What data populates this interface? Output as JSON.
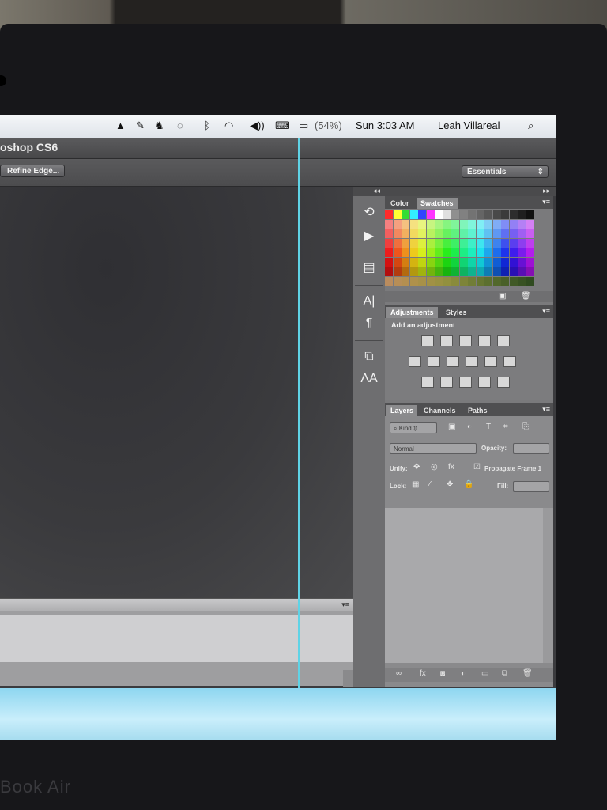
{
  "menubar": {
    "battery_percent": "(54%)",
    "clock": "Sun 3:03 AM",
    "user": "Leah Villareal",
    "search_icon": "magnifier"
  },
  "app": {
    "title": "oshop CS6",
    "refine_edge_label": "Refine Edge...",
    "workspace": "Essentials"
  },
  "color_panel": {
    "tabs": [
      "Color",
      "Swatches"
    ],
    "active_tab": "Swatches"
  },
  "adjustments_panel": {
    "tabs": [
      "Adjustments",
      "Styles"
    ],
    "active_tab": "Adjustments",
    "heading": "Add an adjustment"
  },
  "layers_panel": {
    "tabs": [
      "Layers",
      "Channels",
      "Paths"
    ],
    "active_tab": "Layers",
    "kind_filter": "Kind",
    "blend_mode": "Normal",
    "opacity_label": "Opacity:",
    "unify_label": "Unify:",
    "propagate_label": "Propagate Frame 1",
    "lock_label": "Lock:",
    "fill_label": "Fill:"
  },
  "bottom_text": "Book Air",
  "colors": {
    "guide": "#5fd3e6",
    "panel_bg": "#7a7a7c",
    "canvas_bg": "#3a3a3d"
  }
}
